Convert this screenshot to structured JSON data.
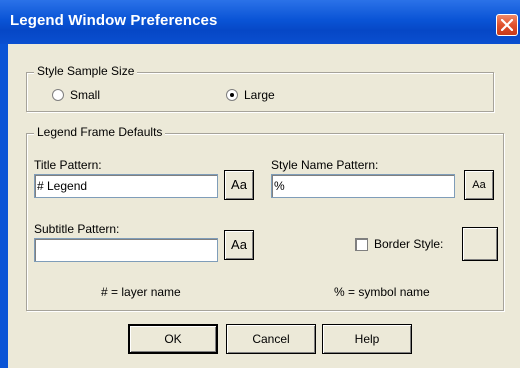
{
  "window": {
    "title": "Legend Window Preferences"
  },
  "style_sample_size": {
    "label": "Style Sample Size",
    "options": [
      {
        "label": "Small",
        "checked": false
      },
      {
        "label": "Large",
        "checked": true
      }
    ]
  },
  "legend_frame_defaults": {
    "label": "Legend Frame Defaults",
    "title_pattern": {
      "label": "Title Pattern:",
      "value": "# Legend"
    },
    "style_name_pattern": {
      "label": "Style Name Pattern:",
      "value": "%"
    },
    "subtitle_pattern": {
      "label": "Subtitle Pattern:",
      "value": ""
    },
    "font_button_label": "Aa",
    "border_style": {
      "label": "Border Style:",
      "checked": false
    },
    "hint_layer": "# = layer name",
    "hint_symbol": "% = symbol name"
  },
  "buttons": {
    "ok": "OK",
    "cancel": "Cancel",
    "help": "Help"
  },
  "colors": {
    "titlebar": "#0A54D6",
    "dialog_bg": "#ECE9D8",
    "close": "#E0512C"
  }
}
